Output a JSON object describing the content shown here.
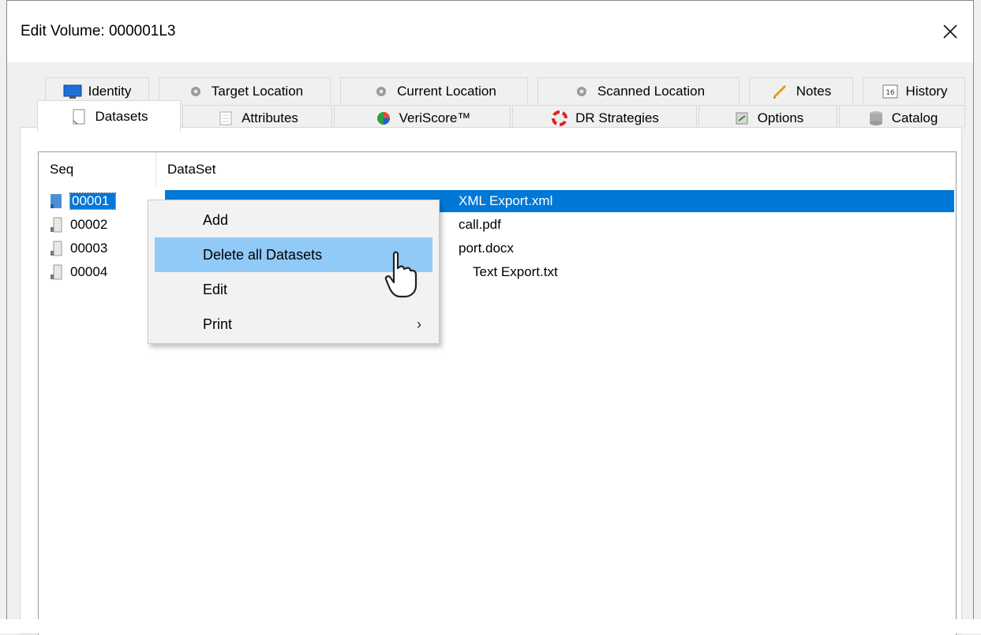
{
  "window": {
    "title": "Edit Volume: 000001L3",
    "close_glyph": "✕"
  },
  "tabs_back": [
    {
      "label": "Identity",
      "icon": "monitor-icon"
    },
    {
      "label": "Target Location",
      "icon": "gear-icon"
    },
    {
      "label": "Current Location",
      "icon": "gear-icon"
    },
    {
      "label": "Scanned Location",
      "icon": "gear-icon"
    },
    {
      "label": "Notes",
      "icon": "pencil-icon"
    },
    {
      "label": "History",
      "icon": "calendar-icon",
      "icon_text": "16"
    }
  ],
  "tabs_front": [
    {
      "label": "Datasets",
      "icon": "document-icon",
      "active": true
    },
    {
      "label": "Attributes",
      "icon": "list-icon"
    },
    {
      "label": "VeriScore™",
      "icon": "pie-chart-icon"
    },
    {
      "label": "DR Strategies",
      "icon": "lifebuoy-icon"
    },
    {
      "label": "Options",
      "icon": "options-icon"
    },
    {
      "label": "Catalog",
      "icon": "database-icon"
    }
  ],
  "list": {
    "columns": [
      "Seq",
      "DataSet"
    ],
    "rows": [
      {
        "seq": "00001",
        "dataset": "XML Export.xml",
        "selected": true
      },
      {
        "seq": "00002",
        "dataset": "call.pdf"
      },
      {
        "seq": "00003",
        "dataset": "port.docx"
      },
      {
        "seq": "00004",
        "dataset": "Text Export.txt"
      }
    ]
  },
  "context_menu": {
    "items": [
      {
        "label": "Add"
      },
      {
        "label": "Delete all Datasets",
        "hover": true
      },
      {
        "label": "Edit",
        "submenu": false
      },
      {
        "label": "Print",
        "submenu": true,
        "arrow": "›"
      }
    ]
  },
  "colors": {
    "selection": "#0078d7",
    "menu_hover": "#91c9f7"
  }
}
